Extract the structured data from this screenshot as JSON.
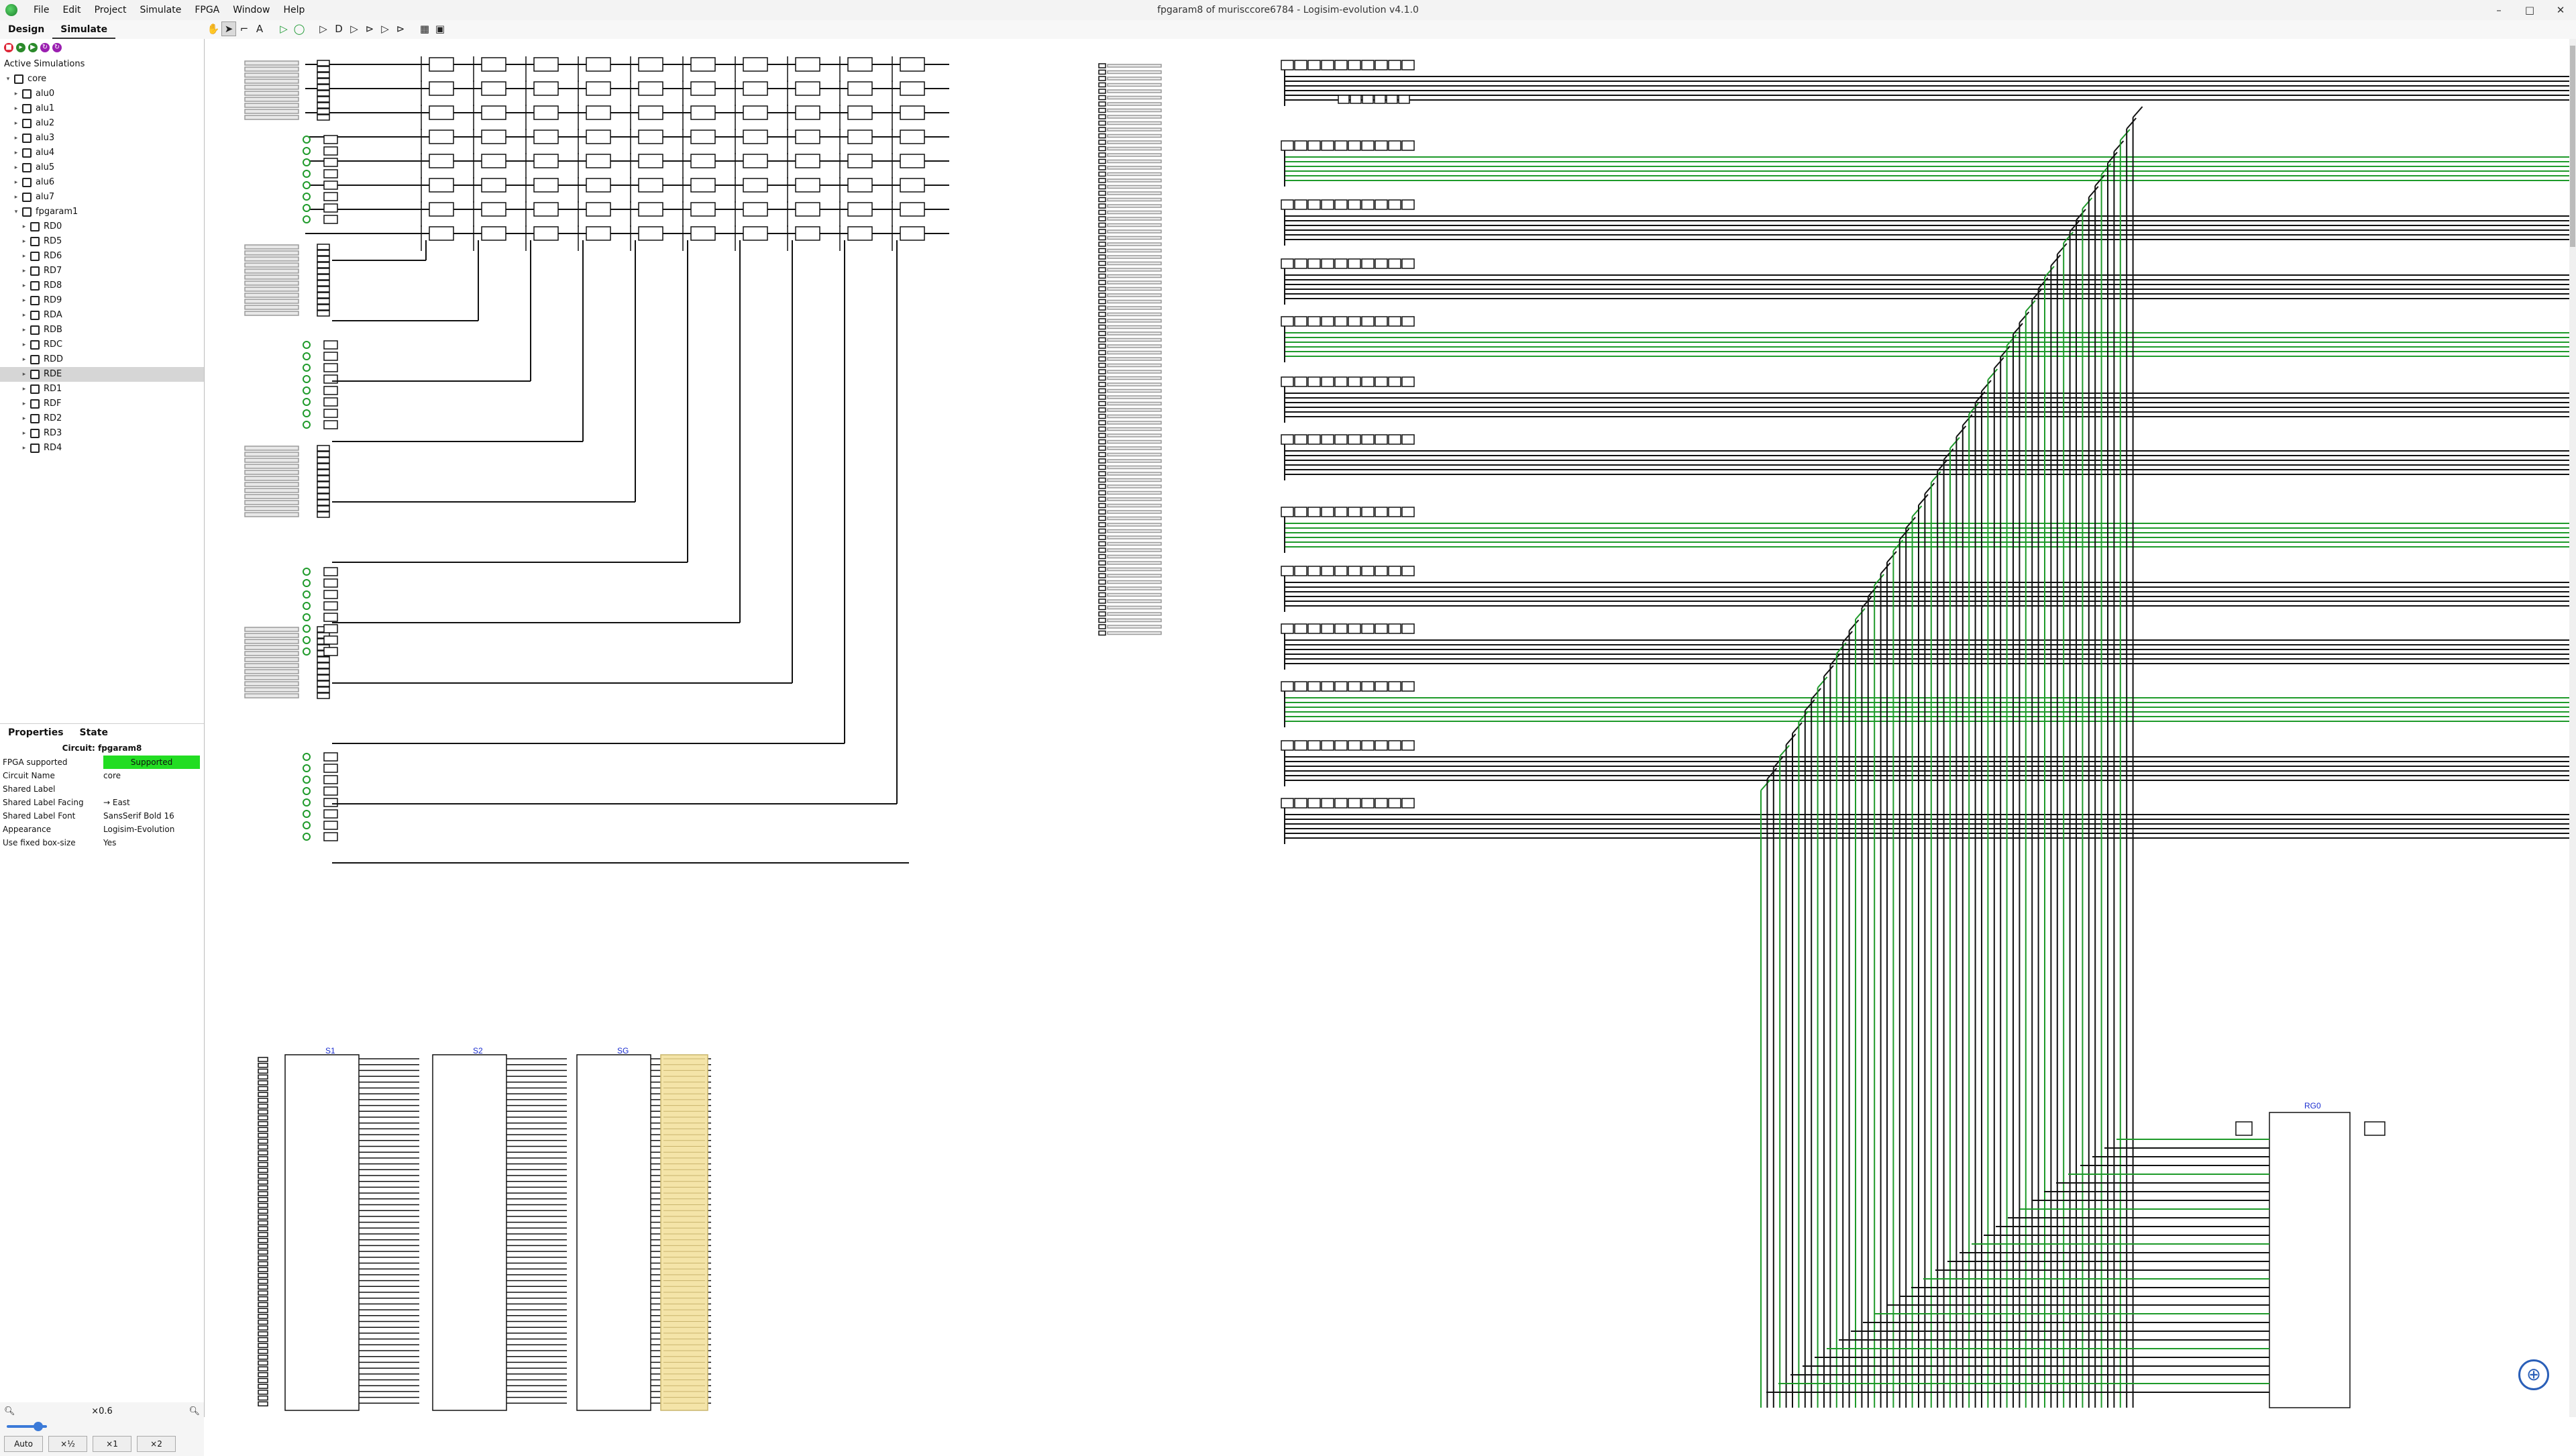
{
  "window": {
    "title": "fpgaram8 of murisccore6784 - Logisim-evolution v4.1.0",
    "controls": [
      "–",
      "□",
      "✕"
    ]
  },
  "menus": [
    "File",
    "Edit",
    "Project",
    "Simulate",
    "FPGA",
    "Window",
    "Help"
  ],
  "left_tabs": [
    "Design",
    "Simulate"
  ],
  "active_left_tab": "Simulate",
  "tree": {
    "header": "Active Simulations",
    "items": [
      {
        "label": "core",
        "level": 0,
        "expanded": true
      },
      {
        "label": "alu0",
        "level": 1
      },
      {
        "label": "alu1",
        "level": 1
      },
      {
        "label": "alu2",
        "level": 1
      },
      {
        "label": "alu3",
        "level": 1
      },
      {
        "label": "alu4",
        "level": 1
      },
      {
        "label": "alu5",
        "level": 1
      },
      {
        "label": "alu6",
        "level": 1
      },
      {
        "label": "alu7",
        "level": 1
      },
      {
        "label": "fpgaram1",
        "level": 1,
        "expanded": true
      },
      {
        "label": "RD0",
        "level": 2
      },
      {
        "label": "RD5",
        "level": 2
      },
      {
        "label": "RD6",
        "level": 2
      },
      {
        "label": "RD7",
        "level": 2
      },
      {
        "label": "RD8",
        "level": 2
      },
      {
        "label": "RD9",
        "level": 2
      },
      {
        "label": "RDA",
        "level": 2
      },
      {
        "label": "RDB",
        "level": 2
      },
      {
        "label": "RDC",
        "level": 2
      },
      {
        "label": "RDD",
        "level": 2
      },
      {
        "label": "RDE",
        "level": 2,
        "selected": true
      },
      {
        "label": "RD1",
        "level": 2
      },
      {
        "label": "RDF",
        "level": 2
      },
      {
        "label": "RD2",
        "level": 2
      },
      {
        "label": "RD3",
        "level": 2
      },
      {
        "label": "RD4",
        "level": 2
      }
    ]
  },
  "properties": {
    "tabs": [
      "Properties",
      "State"
    ],
    "title": "Circuit: fpgaram8",
    "rows": [
      {
        "key": "FPGA supported",
        "value": "Supported"
      },
      {
        "key": "Circuit Name",
        "value": "core"
      },
      {
        "key": "Shared Label",
        "value": ""
      },
      {
        "key": "Shared Label Facing",
        "value": "→ East"
      },
      {
        "key": "Shared Label Font",
        "value": "SansSerif Bold 16"
      },
      {
        "key": "Appearance",
        "value": "Logisim-Evolution"
      },
      {
        "key": "Use fixed box-size",
        "value": "Yes"
      }
    ]
  },
  "zoom": {
    "value": "×0.6",
    "buttons": [
      "Auto",
      "×½",
      "×1",
      "×2"
    ],
    "level": 0.3
  },
  "canvas": {
    "module_labels": [
      "S1",
      "S2",
      "SG"
    ],
    "ram_label": "RG0",
    "colors": {
      "wire_dark": "#111111",
      "wire_green": "#1e9a2a",
      "label_blue": "#1c2fd0",
      "bus_gray": "#9a9a9a",
      "highlight": "#f4e4a8"
    }
  }
}
